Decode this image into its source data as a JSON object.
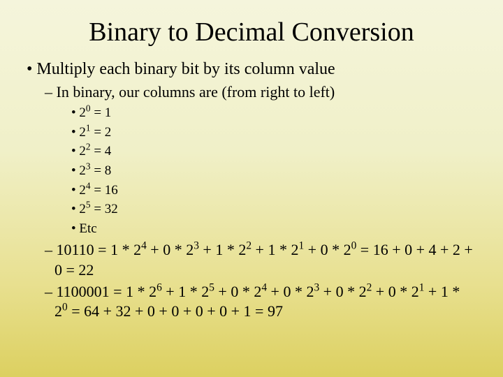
{
  "title": "Binary to Decimal Conversion",
  "bullet1": "Multiply each binary bit by its column value",
  "sub1": "In binary, our columns are (from right to left)",
  "powers": {
    "p0": {
      "base": "2",
      "exp": "0",
      "val": " = 1"
    },
    "p1": {
      "base": "2",
      "exp": "1",
      "val": " = 2"
    },
    "p2": {
      "base": "2",
      "exp": "2",
      "val": " = 4"
    },
    "p3": {
      "base": "2",
      "exp": "3",
      "val": " = 8"
    },
    "p4": {
      "base": "2",
      "exp": "4",
      "val": " = 16"
    },
    "p5": {
      "base": "2",
      "exp": "5",
      "val": " = 32"
    },
    "etc": "Etc"
  },
  "ex1": {
    "t1": "10110 = 1 * 2",
    "e1": "4",
    "t2": " + 0 * 2",
    "e2": "3",
    "t3": " + 1 * 2",
    "e3": "2",
    "t4": " + 1 * 2",
    "e4": "1",
    "t5": " + 0 * 2",
    "e5": "0",
    "t6": " = 16 + 0 + 4 + 2 + 0 = 22"
  },
  "ex2": {
    "t1": "1100001 = 1 * 2",
    "e1": "6",
    "t2": " + 1 * 2",
    "e2": "5",
    "t3": " + 0 * 2",
    "e3": "4",
    "t4": " + 0 * 2",
    "e4": "3",
    "t5": " + 0 * 2",
    "e5": "2",
    "t6": " + 0 * 2",
    "e6": "1",
    "t7": " + 1 * 2",
    "e7": "0",
    "t8": " = 64 + 32 + 0 + 0 + 0 + 0 + 1 = 97"
  }
}
